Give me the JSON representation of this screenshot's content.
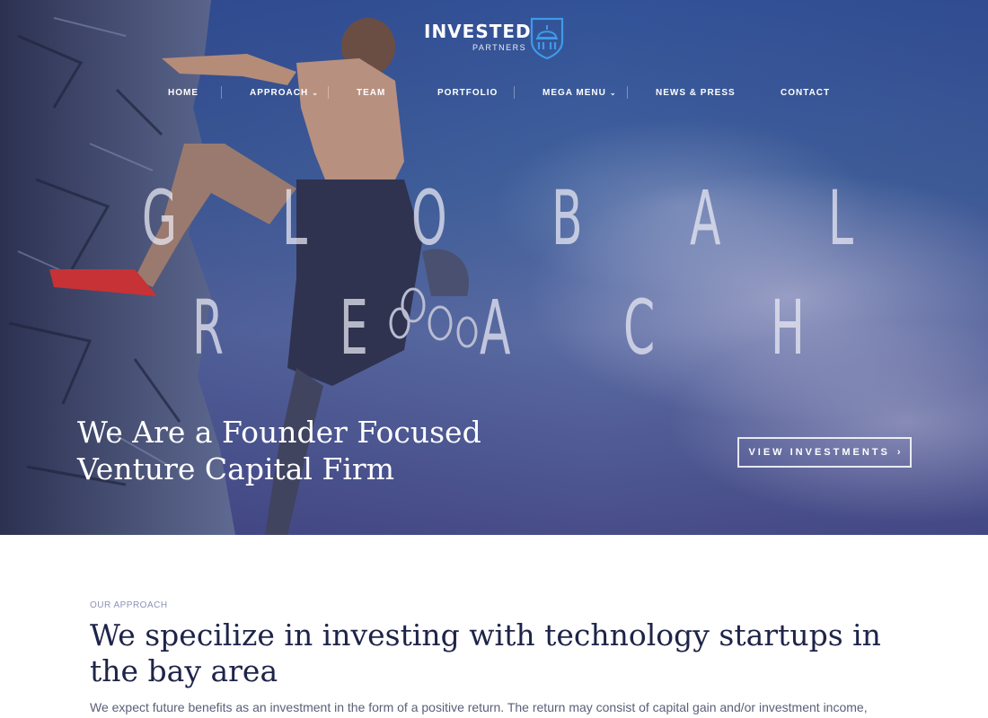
{
  "brand": {
    "name": "INVESTED",
    "sub": "PARTNERS",
    "icon": "dome-shield-icon"
  },
  "nav": {
    "items": [
      {
        "label": "HOME"
      },
      {
        "label": "APPROACH"
      },
      {
        "label": "TEAM"
      },
      {
        "label": "PORTFOLIO"
      },
      {
        "label": "MEGA MENU"
      },
      {
        "label": "NEWS & PRESS"
      },
      {
        "label": "CONTACT"
      }
    ],
    "dropdown_icon": "chevron-down-icon"
  },
  "hero": {
    "line1": [
      "G",
      "L",
      "O",
      "B",
      "A",
      "L"
    ],
    "line2": [
      "R",
      "E",
      "A",
      "C",
      "H"
    ],
    "tagline_1": "We Are a Founder Focused",
    "tagline_2": "Venture Capital Firm",
    "cta_label": "VIEW INVESTMENTS",
    "cta_icon": "chevron-right-icon"
  },
  "approach": {
    "eyebrow": "OUR APPROACH",
    "headline": "We specilize in investing with technology startups in the bay area",
    "body": "We expect future benefits as an investment in the form of a positive return. The return may consist of capital gain and/or investment income,"
  },
  "colors": {
    "accent": "#3d9be9",
    "headline": "#1e2449",
    "eyebrow": "#8a93b8"
  }
}
